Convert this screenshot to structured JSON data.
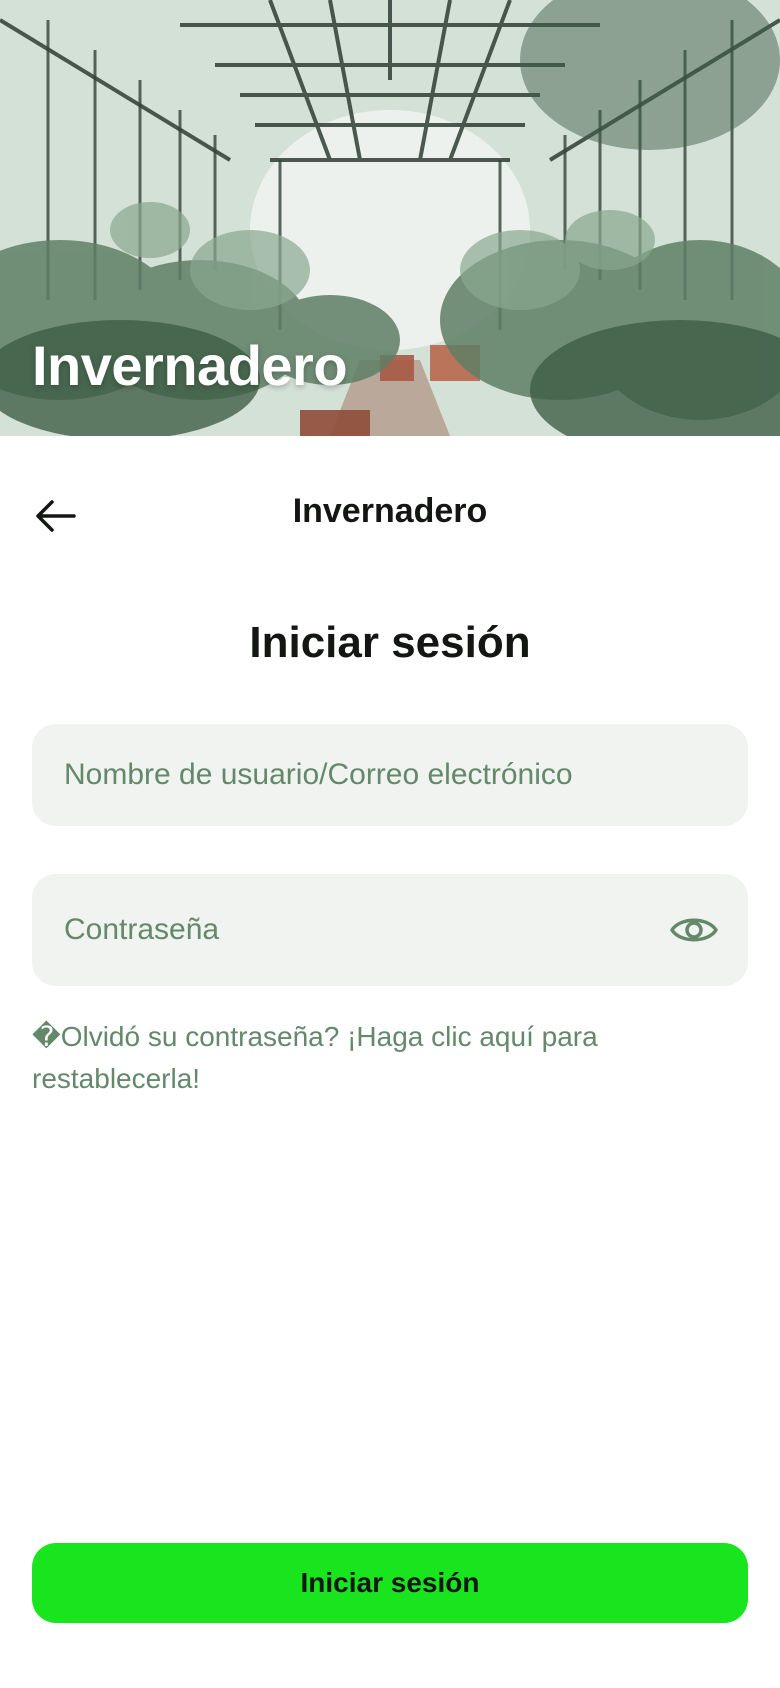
{
  "hero": {
    "title": "Invernadero",
    "image_description_icon": "greenhouse-photo"
  },
  "topbar": {
    "back_icon": "arrow-left-icon",
    "title": "Invernadero"
  },
  "login": {
    "heading": "Iniciar sesión",
    "username_placeholder": "Nombre de usuario/Correo electrónico",
    "username_value": "",
    "password_placeholder": "Contraseña",
    "password_value": "",
    "password_toggle_icon": "eye-icon",
    "forgot_text": "�Olvidó su contraseña? ¡Haga clic aquí para restablecerla!",
    "submit_label": "Iniciar sesión"
  },
  "colors": {
    "primary": "#19e51e",
    "field_bg": "#f0f3f0",
    "muted_green": "#63886a",
    "text": "#131613"
  }
}
